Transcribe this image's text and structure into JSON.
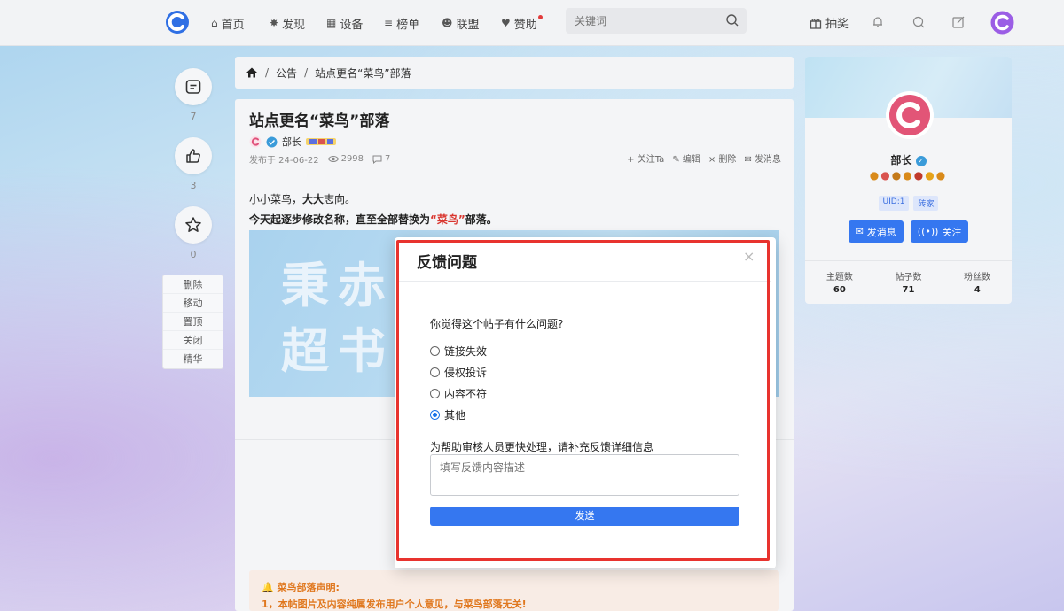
{
  "nav": {
    "items": [
      {
        "label": "首页",
        "icon": "home-icon"
      },
      {
        "label": "发现",
        "icon": "compass-icon"
      },
      {
        "label": "设备",
        "icon": "devices-icon"
      },
      {
        "label": "榜单",
        "icon": "chart-icon"
      },
      {
        "label": "联盟",
        "icon": "people-icon"
      },
      {
        "label": "赞助",
        "icon": "sponsor-icon"
      }
    ],
    "search_placeholder": "关键词",
    "lottery_label": "抽奖"
  },
  "rail": {
    "comment_count": "7",
    "like_count": "3",
    "favorite_count": "0",
    "admin_items": [
      "删除",
      "移动",
      "置顶",
      "关闭",
      "精华"
    ]
  },
  "breadcrumb": {
    "section": "公告",
    "current": "站点更名“菜鸟”部落"
  },
  "post": {
    "title": "站点更名“菜鸟”部落",
    "author": "部长",
    "published": "发布于 24-06-22",
    "views": "2998",
    "comments": "7",
    "actions": [
      "关注Ta",
      "编辑",
      "删除",
      "发消息"
    ],
    "line1_a": "小小菜鸟，",
    "line1_b": "大大",
    "line1_c": "志向。",
    "line2_a": "今天起逐步修改名称，直至全部替换为",
    "line2_b": "“菜鸟”",
    "line2_c": "部落。",
    "image_text_1": "秉赤",
    "image_text_2": "超书",
    "notice_title": "菜鸟部落声明:",
    "notice_line1": "1，本帖图片及内容纯属发布用户个人意见，与菜鸟部落无关!"
  },
  "profile": {
    "name": "部长",
    "uid": "UID:1",
    "rank": "砖家",
    "message_button": "发消息",
    "follow_button": "关注",
    "stats": [
      {
        "label": "主题数",
        "value": "60"
      },
      {
        "label": "帖子数",
        "value": "71"
      },
      {
        "label": "粉丝数",
        "value": "4"
      }
    ]
  },
  "modal": {
    "title": "反馈问题",
    "question": "你觉得这个帖子有什么问题?",
    "options": [
      "链接失效",
      "侵权投诉",
      "内容不符",
      "其他"
    ],
    "selected_option": "其他",
    "detail_label": "为帮助审核人员更快处理，请补充反馈详细信息",
    "detail_placeholder": "填写反馈内容描述",
    "submit_label": "发送"
  },
  "colors": {
    "accent": "#3577f0",
    "highlight_frame": "#e8332e",
    "notice_text": "#e0781f",
    "brand_logo": "#2f6fe4"
  }
}
